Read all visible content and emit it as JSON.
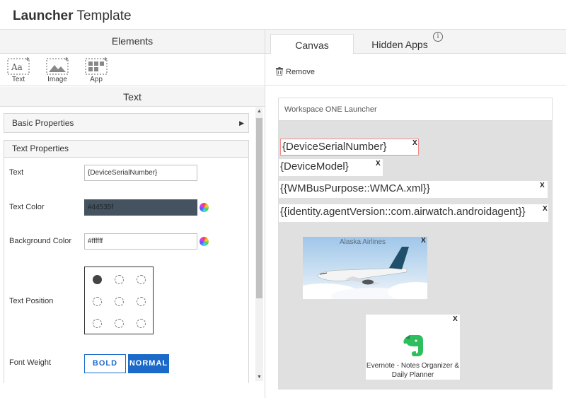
{
  "app": {
    "title_bold": "Launcher",
    "title_light": "Template"
  },
  "header": {
    "elements_label": "Elements",
    "tabs": [
      {
        "label": "Canvas",
        "active": true
      },
      {
        "label": "Hidden Apps",
        "active": false
      }
    ],
    "info_glyph": "i"
  },
  "palette": {
    "items": [
      {
        "label": "Text",
        "icon": "text-element-icon"
      },
      {
        "label": "Image",
        "icon": "image-element-icon"
      },
      {
        "label": "App",
        "icon": "app-element-icon"
      }
    ]
  },
  "properties": {
    "section_title": "Text",
    "basic_label": "Basic Properties",
    "text_props_label": "Text Properties",
    "text_label": "Text",
    "text_value": "{DeviceSerialNumber}",
    "text_color_label": "Text Color",
    "text_color_value": "#44535f",
    "bg_color_label": "Background Color",
    "bg_color_value": "#ffffff",
    "position_label": "Text Position",
    "font_weight_label": "Font Weight",
    "bold_label": "BOLD",
    "normal_label": "NORMAL"
  },
  "toolbar": {
    "remove_label": "Remove"
  },
  "canvas": {
    "title": "Workspace ONE Launcher",
    "text_items": [
      "{DeviceSerialNumber}",
      "{DeviceModel}",
      "{{WMBusPurpose::WMCA.xml}}",
      "{{identity.agentVersion::com.airwatch.androidagent}}"
    ],
    "image_label": "Alaska Airlines",
    "app_name": "Evernote - Notes Organizer & Daily Planner",
    "close_glyph": "X"
  },
  "colors": {
    "accent": "#1b6ac9",
    "text_color": "#44535f",
    "canvas_bg": "#e0e0e0",
    "selected_border": "#f08c8c"
  }
}
